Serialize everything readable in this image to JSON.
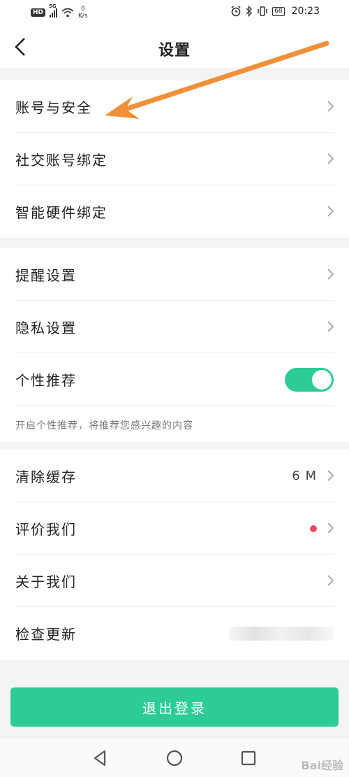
{
  "status_bar": {
    "hd": "HD",
    "network": "5G",
    "speed_value": "0",
    "speed_unit": "K/s",
    "battery": "68",
    "time": "20:23"
  },
  "header": {
    "title": "设置",
    "back_icon": "chevron-left-icon"
  },
  "groups": [
    {
      "items": [
        {
          "label": "账号与安全"
        },
        {
          "label": "社交账号绑定"
        },
        {
          "label": "智能硬件绑定"
        }
      ]
    },
    {
      "items": [
        {
          "label": "提醒设置"
        },
        {
          "label": "隐私设置"
        },
        {
          "label": "个性推荐",
          "toggle": true
        }
      ],
      "hint": "开启个性推荐，将推荐您感兴趣的内容"
    },
    {
      "items": [
        {
          "label": "清除缓存",
          "value": "6 M"
        },
        {
          "label": "评价我们",
          "badge": "red-dot"
        },
        {
          "label": "关于我们"
        },
        {
          "label": "检查更新"
        }
      ]
    }
  ],
  "logout_label": "退出登录",
  "watermark": "Bai经验",
  "colors": {
    "accent": "#2dcc94",
    "badge": "#ef4b5d",
    "annotation_arrow": "#f0913a"
  }
}
